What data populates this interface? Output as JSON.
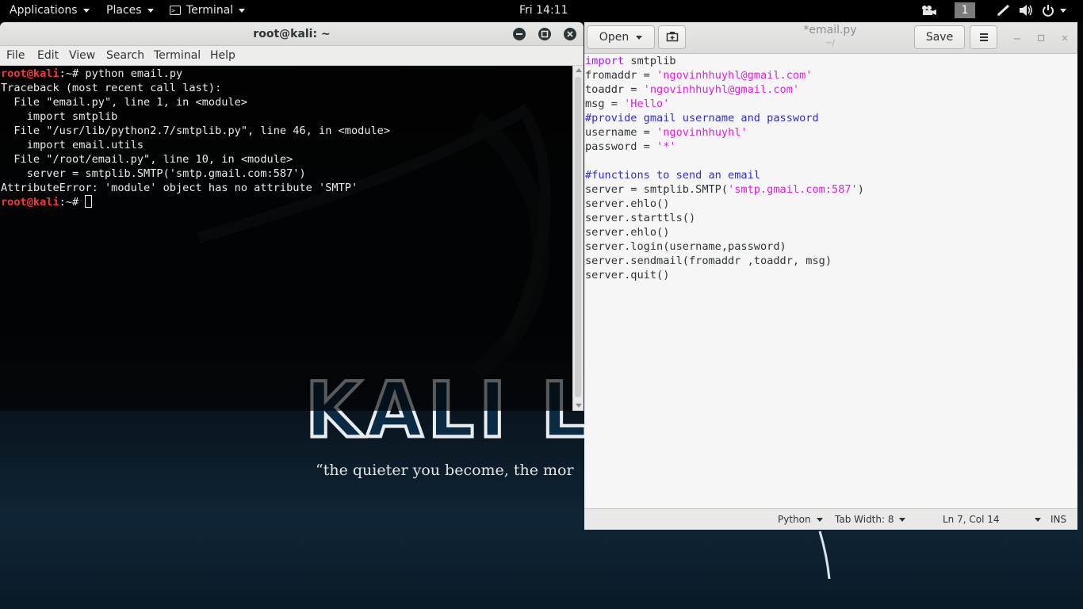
{
  "top_panel": {
    "applications_label": "Applications",
    "places_label": "Places",
    "terminal_label": "Terminal",
    "clock": "Fri 14:11",
    "workspace_number": "1"
  },
  "wallpaper": {
    "logo_text": "KALI LI",
    "tagline": "“the quieter you become, the mor"
  },
  "terminal": {
    "title": "root@kali: ~",
    "menu": [
      "File",
      "Edit",
      "View",
      "Search",
      "Terminal",
      "Help"
    ],
    "prompt_user": "root@kali",
    "prompt_suffix": ":~# ",
    "command": "python email.py",
    "output": [
      "Traceback (most recent call last):",
      "  File \"email.py\", line 1, in <module>",
      "    import smtplib",
      "  File \"/usr/lib/python2.7/smtplib.py\", line 46, in <module>",
      "    import email.utils",
      "  File \"/root/email.py\", line 10, in <module>",
      "    server = smtplib.SMTP('smtp.gmail.com:587')",
      "AttributeError: 'module' object has no attribute 'SMTP'"
    ]
  },
  "gedit": {
    "open_label": "Open",
    "save_label": "Save",
    "title": "*email.py",
    "subtitle": "~/",
    "code": {
      "l1_kw": "import",
      "l1_rest": " smtplib",
      "l2_a": "fromaddr = ",
      "l2_s": "'ngovinhhuyhl@gmail.com'",
      "l3_a": "toaddr = ",
      "l3_s": "'ngovinhhuyhl@gmail.com'",
      "l4_a": "msg = ",
      "l4_s": "'Hello'",
      "l5_c": "#provide gmail username and password",
      "l6_a": "username = ",
      "l6_s": "'ngovinhhuyhl'",
      "l7_a": "password = ",
      "l7_s": "'*'",
      "l9_c": "#functions to send an email",
      "l10_a": "server = smtplib.SMTP(",
      "l10_s": "'smtp.gmail.com:587'",
      "l10_b": ")",
      "l11": "server.ehlo()",
      "l12": "server.starttls()",
      "l13": "server.ehlo()",
      "l14": "server.login(username,password)",
      "l15": "server.sendmail(fromaddr ,toaddr, msg)",
      "l16": "server.quit()"
    },
    "status": {
      "language": "Python",
      "tab_width": "Tab Width: 8",
      "position": "Ln 7, Col 14",
      "mode": "INS"
    }
  }
}
